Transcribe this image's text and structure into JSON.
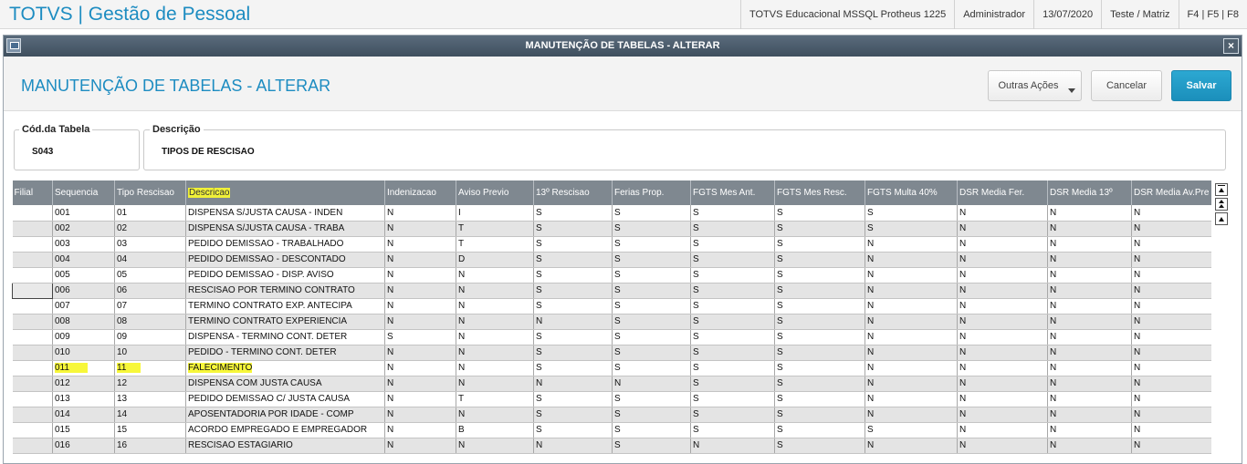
{
  "app": {
    "title": "TOTVS | Gestão de Pessoal",
    "env_items": [
      "TOTVS Educacional MSSQL Protheus 1225",
      "Administrador",
      "13/07/2020",
      "Teste / Matriz",
      "F4 | F5 | F8"
    ]
  },
  "dialog": {
    "window_title": "MANUTENÇÃO DE TABELAS - ALTERAR",
    "heading": "MANUTENÇÃO DE TABELAS - ALTERAR",
    "buttons": {
      "other_actions": "Outras Ações",
      "cancel": "Cancelar",
      "save": "Salvar"
    }
  },
  "fields": {
    "table_code_label": "Cód.da Tabela",
    "table_code_value": "S043",
    "description_label": "Descrição",
    "description_value": "TIPOS DE RESCISAO"
  },
  "grid": {
    "columns": [
      "Filial",
      "Sequencia",
      "Tipo Rescisao",
      "Descricao",
      "Indenizacao",
      "Aviso Previo",
      "13º Rescisao",
      "Ferias Prop.",
      "FGTS Mes Ant.",
      "FGTS Mes Resc.",
      "FGTS Multa 40%",
      "DSR Media Fer.",
      "DSR Media 13º",
      "DSR Media Av.Pre"
    ],
    "highlighted_column": "Descricao",
    "highlighted_row_sequence": "011",
    "selected_cell": {
      "row_index": 5,
      "column": "Filial"
    },
    "highlight_color": "#f7f73a",
    "header_color": "#7f8890",
    "rows": [
      [
        "",
        "001",
        "01",
        "DISPENSA S/JUSTA CAUSA - INDEN",
        "N",
        "I",
        "S",
        "S",
        "S",
        "S",
        "S",
        "N",
        "N",
        "N"
      ],
      [
        "",
        "002",
        "02",
        "DISPENSA S/JUSTA CAUSA - TRABA",
        "N",
        "T",
        "S",
        "S",
        "S",
        "S",
        "S",
        "N",
        "N",
        "N"
      ],
      [
        "",
        "003",
        "03",
        "PEDIDO DEMISSAO - TRABALHADO",
        "N",
        "T",
        "S",
        "S",
        "S",
        "S",
        "N",
        "N",
        "N",
        "N"
      ],
      [
        "",
        "004",
        "04",
        "PEDIDO DEMISSAO - DESCONTADO",
        "N",
        "D",
        "S",
        "S",
        "S",
        "S",
        "N",
        "N",
        "N",
        "N"
      ],
      [
        "",
        "005",
        "05",
        "PEDIDO DEMISSAO - DISP. AVISO",
        "N",
        "N",
        "S",
        "S",
        "S",
        "S",
        "N",
        "N",
        "N",
        "N"
      ],
      [
        "",
        "006",
        "06",
        "RESCISAO POR TERMINO CONTRATO",
        "N",
        "N",
        "S",
        "S",
        "S",
        "S",
        "N",
        "N",
        "N",
        "N"
      ],
      [
        "",
        "007",
        "07",
        "TERMINO CONTRATO EXP. ANTECIPA",
        "N",
        "N",
        "S",
        "S",
        "S",
        "S",
        "N",
        "N",
        "N",
        "N"
      ],
      [
        "",
        "008",
        "08",
        "TERMINO CONTRATO EXPERIENCIA",
        "N",
        "N",
        "N",
        "S",
        "S",
        "S",
        "N",
        "N",
        "N",
        "N"
      ],
      [
        "",
        "009",
        "09",
        "DISPENSA - TERMINO CONT. DETER",
        "S",
        "N",
        "S",
        "S",
        "S",
        "S",
        "N",
        "N",
        "N",
        "N"
      ],
      [
        "",
        "010",
        "10",
        "PEDIDO - TERMINO CONT. DETER",
        "N",
        "N",
        "S",
        "S",
        "S",
        "S",
        "N",
        "N",
        "N",
        "N"
      ],
      [
        "",
        "011",
        "11",
        "FALECIMENTO",
        "N",
        "N",
        "S",
        "S",
        "S",
        "S",
        "N",
        "N",
        "N",
        "N"
      ],
      [
        "",
        "012",
        "12",
        "DISPENSA COM JUSTA CAUSA",
        "N",
        "N",
        "N",
        "N",
        "S",
        "S",
        "N",
        "N",
        "N",
        "N"
      ],
      [
        "",
        "013",
        "13",
        "PEDIDO DEMISSAO C/ JUSTA CAUSA",
        "N",
        "T",
        "S",
        "S",
        "S",
        "S",
        "N",
        "N",
        "N",
        "N"
      ],
      [
        "",
        "014",
        "14",
        "APOSENTADORIA POR IDADE - COMP",
        "N",
        "N",
        "S",
        "S",
        "S",
        "S",
        "N",
        "N",
        "N",
        "N"
      ],
      [
        "",
        "015",
        "15",
        "ACORDO EMPREGADO E EMPREGADOR",
        "N",
        "B",
        "S",
        "S",
        "S",
        "S",
        "S",
        "N",
        "N",
        "N"
      ],
      [
        "",
        "016",
        "16",
        "RESCISAO ESTAGIARIO",
        "N",
        "N",
        "N",
        "S",
        "N",
        "S",
        "N",
        "N",
        "N",
        "N"
      ]
    ]
  }
}
